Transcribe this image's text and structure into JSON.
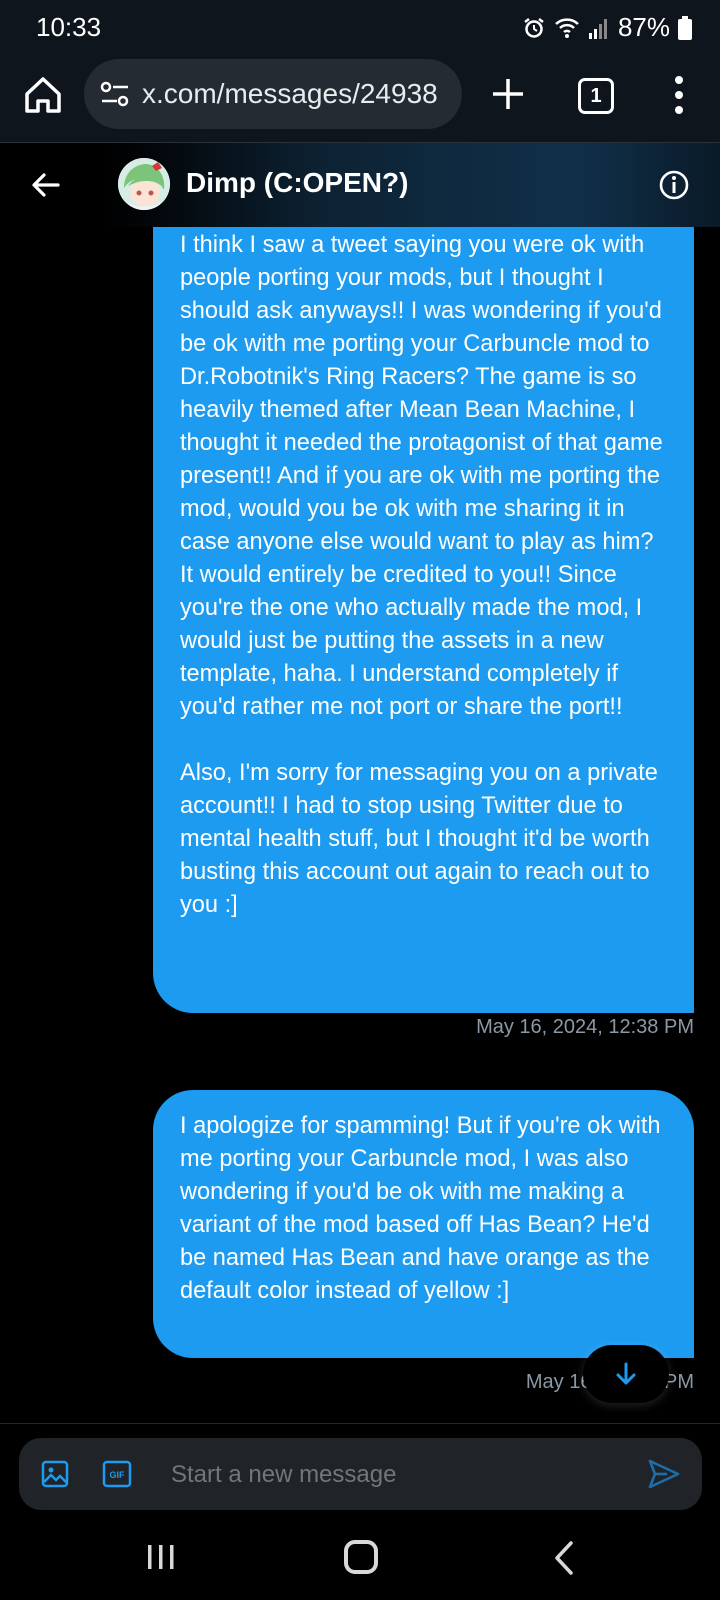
{
  "status_bar": {
    "time": "10:33",
    "battery": "87%"
  },
  "browser": {
    "url": "x.com/messages/24938",
    "tab_count": "1"
  },
  "conversation": {
    "title": "Dimp (C:OPEN?)",
    "avatar_icon": "anime-avatar"
  },
  "messages": [
    {
      "paragraphs": [
        "I think I saw a tweet saying you were ok with people porting your mods, but I thought I should ask anyways!! I was wondering if you'd be ok with me porting your Carbuncle mod to Dr.Robotnik's Ring Racers? The game is so heavily themed after Mean Bean Machine, I thought it needed the protagonist of that game present!! And if you are ok with me porting the mod, would you be ok with me sharing it in case anyone else would want to play as him? It would entirely be credited to you!! Since you're the one who actually made the mod, I would just be putting the assets in a new template, haha. I understand completely if you'd rather me not port or share the port!!",
        "Also, I'm sorry for messaging you on a private account!! I had to stop using Twitter due to mental health stuff, but I thought it'd be worth busting this account out again to reach out to you :]"
      ],
      "timestamp": "May 16, 2024, 12:38 PM"
    },
    {
      "paragraphs": [
        "I apologize for spamming! But if you're ok with me porting your Carbuncle mod, I was also wondering if you'd be ok with me making a variant of the mod based off Has Bean? He'd be named Has Bean and have orange as the default color instead of yellow :]"
      ],
      "timestamp": "May 16, 202       PM"
    }
  ],
  "composer": {
    "placeholder": "Start a new message"
  },
  "colors": {
    "accent": "#1d9bf0",
    "background": "#000000",
    "composer_bg": "#202327",
    "timestamp": "#8b98a5"
  }
}
